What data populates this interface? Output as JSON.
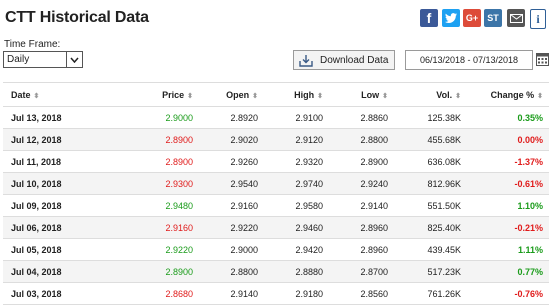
{
  "header": {
    "title": "CTT Historical Data",
    "share_icons": [
      "facebook-icon",
      "twitter-icon",
      "google-plus-icon",
      "stocktwits-icon",
      "mail-icon",
      "info-icon"
    ]
  },
  "controls": {
    "time_frame_label": "Time Frame:",
    "time_frame_value": "Daily",
    "download_label": "Download Data",
    "date_range": "06/13/2018 - 07/13/2018"
  },
  "colors": {
    "up": "#1a9b1a",
    "down": "#e01b1b"
  },
  "table": {
    "headers": {
      "date": "Date",
      "price": "Price",
      "open": "Open",
      "high": "High",
      "low": "Low",
      "vol": "Vol.",
      "change": "Change %"
    },
    "rows": [
      {
        "date": "Jul 13, 2018",
        "price": "2.9000",
        "open": "2.8920",
        "high": "2.9100",
        "low": "2.8860",
        "vol": "125.38K",
        "change": "0.35%",
        "dir": "up"
      },
      {
        "date": "Jul 12, 2018",
        "price": "2.8900",
        "open": "2.9020",
        "high": "2.9120",
        "low": "2.8800",
        "vol": "455.68K",
        "change": "0.00%",
        "dir": "down"
      },
      {
        "date": "Jul 11, 2018",
        "price": "2.8900",
        "open": "2.9260",
        "high": "2.9320",
        "low": "2.8900",
        "vol": "636.08K",
        "change": "-1.37%",
        "dir": "down"
      },
      {
        "date": "Jul 10, 2018",
        "price": "2.9300",
        "open": "2.9540",
        "high": "2.9740",
        "low": "2.9240",
        "vol": "812.96K",
        "change": "-0.61%",
        "dir": "down"
      },
      {
        "date": "Jul 09, 2018",
        "price": "2.9480",
        "open": "2.9160",
        "high": "2.9580",
        "low": "2.9140",
        "vol": "551.50K",
        "change": "1.10%",
        "dir": "up"
      },
      {
        "date": "Jul 06, 2018",
        "price": "2.9160",
        "open": "2.9220",
        "high": "2.9460",
        "low": "2.8960",
        "vol": "825.40K",
        "change": "-0.21%",
        "dir": "down"
      },
      {
        "date": "Jul 05, 2018",
        "price": "2.9220",
        "open": "2.9000",
        "high": "2.9420",
        "low": "2.8960",
        "vol": "439.45K",
        "change": "1.11%",
        "dir": "up"
      },
      {
        "date": "Jul 04, 2018",
        "price": "2.8900",
        "open": "2.8800",
        "high": "2.8880",
        "low": "2.8700",
        "vol": "517.23K",
        "change": "0.77%",
        "dir": "up"
      },
      {
        "date": "Jul 03, 2018",
        "price": "2.8680",
        "open": "2.9140",
        "high": "2.9180",
        "low": "2.8560",
        "vol": "761.26K",
        "change": "-0.76%",
        "dir": "down"
      }
    ]
  }
}
